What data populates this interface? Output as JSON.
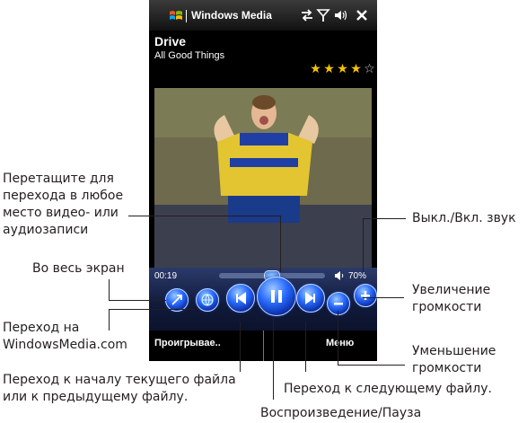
{
  "titlebar": {
    "app_title": "Windows Media",
    "icons": [
      "windows-logo-icon",
      "connectivity-icon",
      "signal-icon",
      "volume-icon",
      "close-icon"
    ]
  },
  "track": {
    "title": "Drive",
    "artist": "All Good Things",
    "rating": 4,
    "rating_max": 5
  },
  "player": {
    "elapsed": "00:19",
    "volume_label": "70%",
    "seek_position": 0.5,
    "volume_level": 0.7
  },
  "buttons": [
    "fullscreen",
    "windowsmedia-web",
    "previous",
    "play-pause",
    "next",
    "volume-down",
    "volume-up"
  ],
  "softkeys": {
    "left": "Проигрывае..",
    "right": "Меню"
  },
  "annotations": {
    "seek": "Перетащите для перехода в любое место видео- или аудиозаписи",
    "mute": "Выкл./Вкл. звук",
    "fullscreen": "Во весь экран",
    "volume_up": "Увеличение громкости",
    "web": "Переход на WindowsMedia.com",
    "volume_down": "Уменьшение громкости",
    "previous": "Переход к началу текущего файла или к предыдущему файлу.",
    "next": "Переход к следующему файлу.",
    "play_pause": "Воспроизведение/Пауза"
  }
}
